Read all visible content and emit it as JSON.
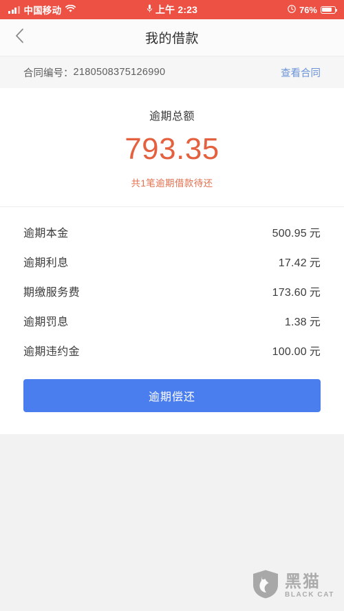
{
  "status_bar": {
    "carrier": "中国移动",
    "signal_icon": "signal-bars-icon",
    "wifi_icon": "wifi-icon",
    "mic_icon": "microphone-icon",
    "time": "上午 2:23",
    "alarm_icon": "alarm-clock-icon",
    "battery_percent": "76%",
    "battery_icon": "battery-icon",
    "background_color": "#ed5144",
    "text_color": "#ffffff"
  },
  "navbar": {
    "back_icon": "chevron-left-icon",
    "title": "我的借款"
  },
  "contract": {
    "label": "合同编号：",
    "number": "2180508375126990",
    "link_label": "查看合同",
    "link_color": "#6a93d8"
  },
  "summary": {
    "title": "逾期总额",
    "amount": "793.35",
    "amount_color": "#e4613f",
    "note": "共1笔逾期借款待还"
  },
  "details": {
    "rows": [
      {
        "label": "逾期本金",
        "value": "500.95",
        "unit": "元"
      },
      {
        "label": "逾期利息",
        "value": "17.42",
        "unit": "元"
      },
      {
        "label": "期缴服务费",
        "value": "173.60",
        "unit": "元"
      },
      {
        "label": "逾期罚息",
        "value": "1.38",
        "unit": "元"
      },
      {
        "label": "逾期违约金",
        "value": "100.00",
        "unit": "元"
      }
    ]
  },
  "action": {
    "pay_label": "逾期偿还",
    "button_color": "#4a7ded"
  },
  "watermark": {
    "logo_icon": "black-cat-shield-icon",
    "name_cn": "黑猫",
    "name_en": "BLACK CAT"
  }
}
